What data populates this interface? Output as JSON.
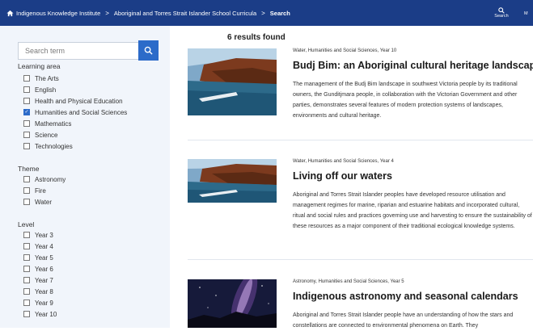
{
  "breadcrumb": {
    "items": [
      "Indigenous Knowledge Institute",
      "Aboriginal and Torres Strait Islander School Curricula",
      "Search"
    ],
    "separator": ">"
  },
  "header": {
    "search_label": "Search",
    "more_label": "M"
  },
  "sidebar": {
    "search_placeholder": "Search term",
    "facets": [
      {
        "title": "Learning area",
        "items": [
          {
            "label": "The Arts",
            "checked": false
          },
          {
            "label": "English",
            "checked": false
          },
          {
            "label": "Health and Physical Education",
            "checked": false
          },
          {
            "label": "Humanities and Social Sciences",
            "checked": true
          },
          {
            "label": "Mathematics",
            "checked": false
          },
          {
            "label": "Science",
            "checked": false
          },
          {
            "label": "Technologies",
            "checked": false
          }
        ]
      },
      {
        "title": "Theme",
        "items": [
          {
            "label": "Astronomy",
            "checked": false
          },
          {
            "label": "Fire",
            "checked": false
          },
          {
            "label": "Water",
            "checked": false
          }
        ]
      },
      {
        "title": "Level",
        "items": [
          {
            "label": "Year 3",
            "checked": false
          },
          {
            "label": "Year 4",
            "checked": false
          },
          {
            "label": "Year 5",
            "checked": false
          },
          {
            "label": "Year 6",
            "checked": false
          },
          {
            "label": "Year 7",
            "checked": false
          },
          {
            "label": "Year 8",
            "checked": false
          },
          {
            "label": "Year 9",
            "checked": false
          },
          {
            "label": "Year 10",
            "checked": false
          }
        ]
      }
    ]
  },
  "results": {
    "count_text": "6 results found",
    "items": [
      {
        "meta": "Water, Humanities and Social Sciences, Year 10",
        "title": "Budj Bim: an Aboriginal cultural heritage landscape",
        "description": "The management of the Budj Bim landscape in southwest Victoria people by its traditional owners, the Gunditjmara people, in collaboration with the Victorian Government and other parties, demonstrates several features of modern protection systems of landscapes, environments and cultural heritage.",
        "image": "river-gorge"
      },
      {
        "meta": "Water, Humanities and Social Sciences, Year 4",
        "title": "Living off our waters",
        "description": "Aboriginal and Torres Strait Islander peoples have developed resource utilisation and management regimes for marine, riparian and estuarine habitats and incorporated cultural, ritual and social rules and practices governing use and harvesting to ensure the sustainability of these resources as a major component of their traditional ecological knowledge systems.",
        "image": "river-gorge"
      },
      {
        "meta": "Astronomy, Humanities and Social Sciences, Year 5",
        "title": "Indigenous astronomy and seasonal calendars",
        "description": "Aboriginal and Torres Strait Islander people have an understanding of how the stars and constellations are connected to environmental phenomena on Earth. They",
        "image": "night-sky"
      }
    ]
  },
  "colors": {
    "header_bg": "#1b3d87",
    "sidebar_bg": "#f1f5fb",
    "accent": "#2c6bc9"
  }
}
